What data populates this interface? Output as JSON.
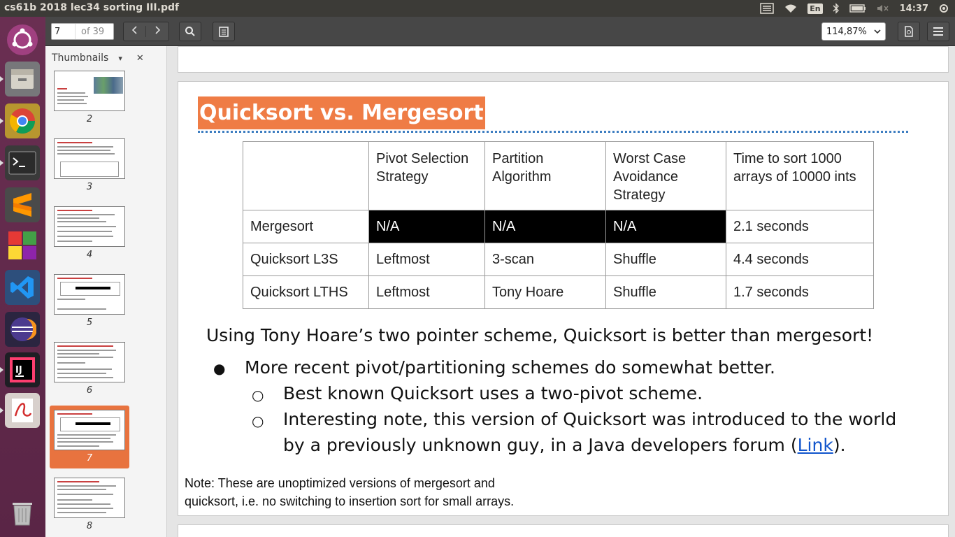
{
  "window": {
    "title": "cs61b 2018 lec34 sorting III.pdf",
    "clock": "14:37",
    "lang": "En"
  },
  "toolbar": {
    "page_value": "7",
    "page_total": "of 39",
    "zoom": "114,87%"
  },
  "sidebar": {
    "title": "Thumbnails",
    "thumbnails": [
      {
        "num": "2",
        "selected": false
      },
      {
        "num": "3",
        "selected": false
      },
      {
        "num": "4",
        "selected": false
      },
      {
        "num": "5",
        "selected": false
      },
      {
        "num": "6",
        "selected": false
      },
      {
        "num": "7",
        "selected": true
      },
      {
        "num": "8",
        "selected": false
      }
    ]
  },
  "slide": {
    "title": "Quicksort vs. Mergesort",
    "table": {
      "headers": [
        "",
        "Pivot Selection Strategy",
        "Partition Algorithm",
        "Worst Case Avoidance Strategy",
        "Time to sort 1000 arrays of 10000 ints"
      ],
      "rows": [
        [
          "Mergesort",
          "N/A",
          "N/A",
          "N/A",
          "2.1 seconds"
        ],
        [
          "Quicksort L3S",
          "Leftmost",
          "3-scan",
          "Shuffle",
          "4.4 seconds"
        ],
        [
          "Quicksort LTHS",
          "Leftmost",
          "Tony Hoare",
          "Shuffle",
          "1.7 seconds"
        ]
      ]
    },
    "paragraph": "Using Tony Hoare’s two pointer scheme, Quicksort is better than mergesort!",
    "bullet1": "More recent pivot/partitioning schemes do somewhat better.",
    "sub1": "Best known Quicksort uses a two-pivot scheme.",
    "sub2_line1": "Interesting note, this version of Quicksort was introduced to the world",
    "sub2_line2_pre": "by a previously unknown guy, in a Java developers forum (",
    "sub2_link": "Link",
    "sub2_line2_post": ").",
    "note_line1": "Note: These are unoptimized versions of mergesort and",
    "note_line2": "quicksort, i.e. no switching to insertion sort for small arrays."
  },
  "colors": {
    "title_bg": "#ef7c45",
    "accent_selected": "#e8733f",
    "link": "#1155cc"
  }
}
